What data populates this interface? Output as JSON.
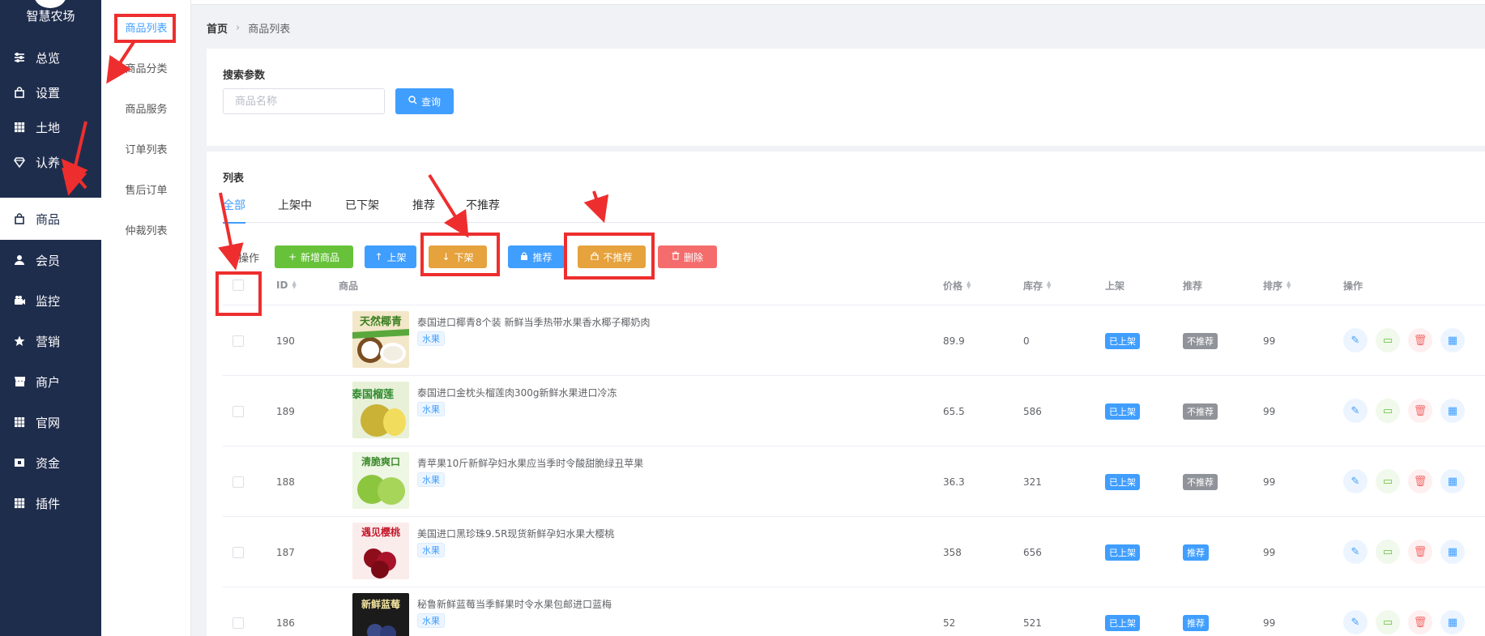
{
  "app": {
    "name": "智慧农场"
  },
  "sidebar": {
    "items": [
      {
        "label": "总览",
        "icon": "sliders-icon"
      },
      {
        "label": "设置",
        "icon": "bag-icon"
      },
      {
        "label": "土地",
        "icon": "grid-icon"
      },
      {
        "label": "认养",
        "icon": "gem-icon"
      },
      {
        "label": "商品",
        "icon": "bag-icon",
        "active": true
      },
      {
        "label": "会员",
        "icon": "user-icon"
      },
      {
        "label": "监控",
        "icon": "camera-icon"
      },
      {
        "label": "营销",
        "icon": "star-icon"
      },
      {
        "label": "商户",
        "icon": "store-icon"
      },
      {
        "label": "官网",
        "icon": "grid-icon"
      },
      {
        "label": "资金",
        "icon": "wallet-icon"
      },
      {
        "label": "插件",
        "icon": "grid-icon"
      }
    ]
  },
  "subnav": {
    "items": [
      "商品列表",
      "商品分类",
      "商品服务",
      "订单列表",
      "售后订单",
      "仲裁列表"
    ]
  },
  "breadcrumb": {
    "home": "首页",
    "current": "商品列表"
  },
  "search": {
    "title": "搜索参数",
    "placeholder": "商品名称",
    "query_label": "查询"
  },
  "list": {
    "title": "列表",
    "tabs": [
      "全部",
      "上架中",
      "已下架",
      "推荐",
      "不推荐"
    ],
    "ops_label": "操作",
    "buttons": {
      "add": "新增商品",
      "up": "上架",
      "down": "下架",
      "recommend": "推荐",
      "unrecommend": "不推荐",
      "delete": "删除"
    },
    "columns": {
      "id": "ID",
      "product": "商品",
      "price": "价格",
      "stock": "库存",
      "shelf": "上架",
      "recommend": "推荐",
      "sort": "排序",
      "actions": "操作"
    },
    "rows": [
      {
        "id": "190",
        "name": "泰国进口椰青8个装 新鲜当季热带水果香水椰子椰奶肉",
        "category": "水果",
        "price": "89.9",
        "stock": "0",
        "shelf": "已上架",
        "recommend": "不推荐",
        "sort": "99",
        "thumb_text": "天然椰青"
      },
      {
        "id": "189",
        "name": "泰国进口金枕头榴莲肉300g新鲜水果进口冷冻",
        "category": "水果",
        "price": "65.5",
        "stock": "586",
        "shelf": "已上架",
        "recommend": "不推荐",
        "sort": "99",
        "thumb_text": "泰国榴莲"
      },
      {
        "id": "188",
        "name": "青苹果10斤新鲜孕妇水果应当季时令酸甜脆绿丑苹果",
        "category": "水果",
        "price": "36.3",
        "stock": "321",
        "shelf": "已上架",
        "recommend": "不推荐",
        "sort": "99",
        "thumb_text": "清脆爽口"
      },
      {
        "id": "187",
        "name": "美国进口黑珍珠9.5R现货新鲜孕妇水果大樱桃",
        "category": "水果",
        "price": "358",
        "stock": "656",
        "shelf": "已上架",
        "recommend": "推荐",
        "sort": "99",
        "thumb_text": "遇见樱桃"
      },
      {
        "id": "186",
        "name": "秘鲁新鲜蓝莓当季鲜果时令水果包邮进口蓝梅",
        "category": "水果",
        "price": "52",
        "stock": "521",
        "shelf": "已上架",
        "recommend": "推荐",
        "sort": "99",
        "thumb_text": "新鲜蓝莓"
      }
    ]
  },
  "colors": {
    "sidebar_bg": "#1f2d4d",
    "primary": "#409eff",
    "success": "#67c23a",
    "warning": "#e6a23c",
    "danger": "#f56c6c",
    "annotation": "#ee2e2e"
  }
}
